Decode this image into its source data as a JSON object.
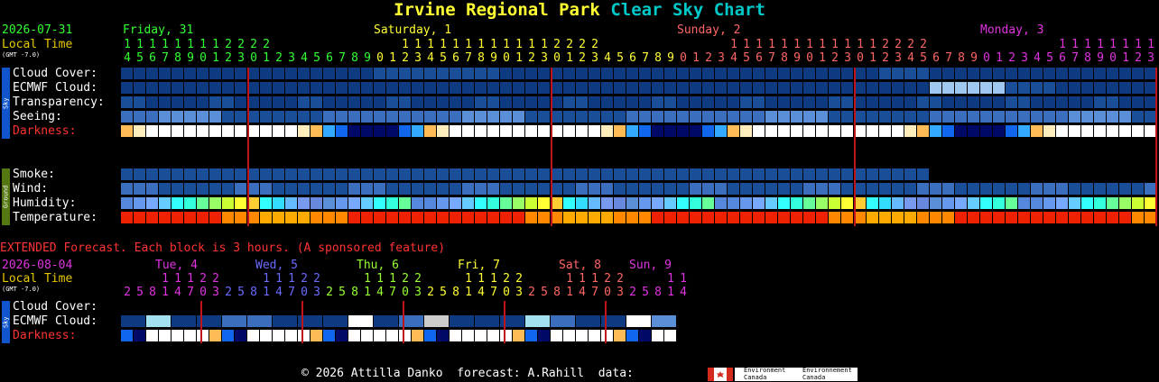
{
  "title": {
    "park": "Irvine Regional Park",
    "chart": "Clear Sky Chart"
  },
  "colors": {
    "park": "#ffff33",
    "chart": "#00c8c8",
    "date": "#33ff33",
    "localtime": "#e6c800",
    "gmt": "#ffffff",
    "days": [
      "#33ff33",
      "#ffff33",
      "#ff6666",
      "#e033e0"
    ],
    "extended": "#ff3333",
    "vline": "#c0141c"
  },
  "main": {
    "date": "2026-07-31",
    "local_time": "Local Time",
    "gmt": "(GMT -7.0)",
    "days": [
      {
        "label": "Friday, 31",
        "startHour": 4
      },
      {
        "label": "Saturday, 1",
        "startHour": 0
      },
      {
        "label": "Sunday, 2",
        "startHour": 0
      },
      {
        "label": "Monday, 3",
        "startHour": 0
      }
    ],
    "hours_top": "1111111122220000000000111111111111222200000000001111111111112222000000000011111111111122222",
    "hours_bottom": "4567890123012345678901234567890123012345678901234567890123012345678901234567890123",
    "sky_section_label": "Sky",
    "ground_section_label": "Ground",
    "rows": [
      {
        "label": "Cloud Cover:",
        "color": "#ffffff"
      },
      {
        "label": "ECMWF Cloud:",
        "color": "#ffffff"
      },
      {
        "label": "Transparency:",
        "color": "#ffffff"
      },
      {
        "label": "Seeing:",
        "color": "#ffffff"
      },
      {
        "label": "Darkness:",
        "color": "#ff3333"
      },
      {
        "label": "Smoke:",
        "color": "#ffffff"
      },
      {
        "label": "Wind:",
        "color": "#ffffff"
      },
      {
        "label": "Humidity:",
        "color": "#ffffff"
      },
      {
        "label": "Temperature:",
        "color": "#ffffff"
      }
    ]
  },
  "extended": {
    "banner": "EXTENDED Forecast. Each block is 3 hours. (A sponsored feature)",
    "date": "2026-08-04",
    "local_time": "Local Time",
    "gmt": "(GMT -7.0)",
    "days": [
      {
        "label": "Tue, 4",
        "color": "#e033e0"
      },
      {
        "label": "Wed, 5",
        "color": "#6a6aff"
      },
      {
        "label": "Thu, 6",
        "color": "#99ff33"
      },
      {
        "label": "Fri, 7",
        "color": "#ffff33"
      },
      {
        "label": "Sat, 8",
        "color": "#ff6666"
      },
      {
        "label": "Sun, 9",
        "color": "#e033e0"
      }
    ],
    "hours": "258147032581470325814703258147032581470325814",
    "rows": [
      {
        "label": "Cloud Cover:",
        "color": "#ffffff"
      },
      {
        "label": "ECMWF Cloud:",
        "color": "#ffffff"
      },
      {
        "label": "Darkness:",
        "color": "#ff3333"
      }
    ],
    "sky_section_label": "Sky"
  },
  "footer": {
    "text": "© 2026 Attilla Danko  forecast: A.Rahill  data:",
    "env_en": "Environment Canada",
    "env_fr": "Environnement Canada"
  }
}
